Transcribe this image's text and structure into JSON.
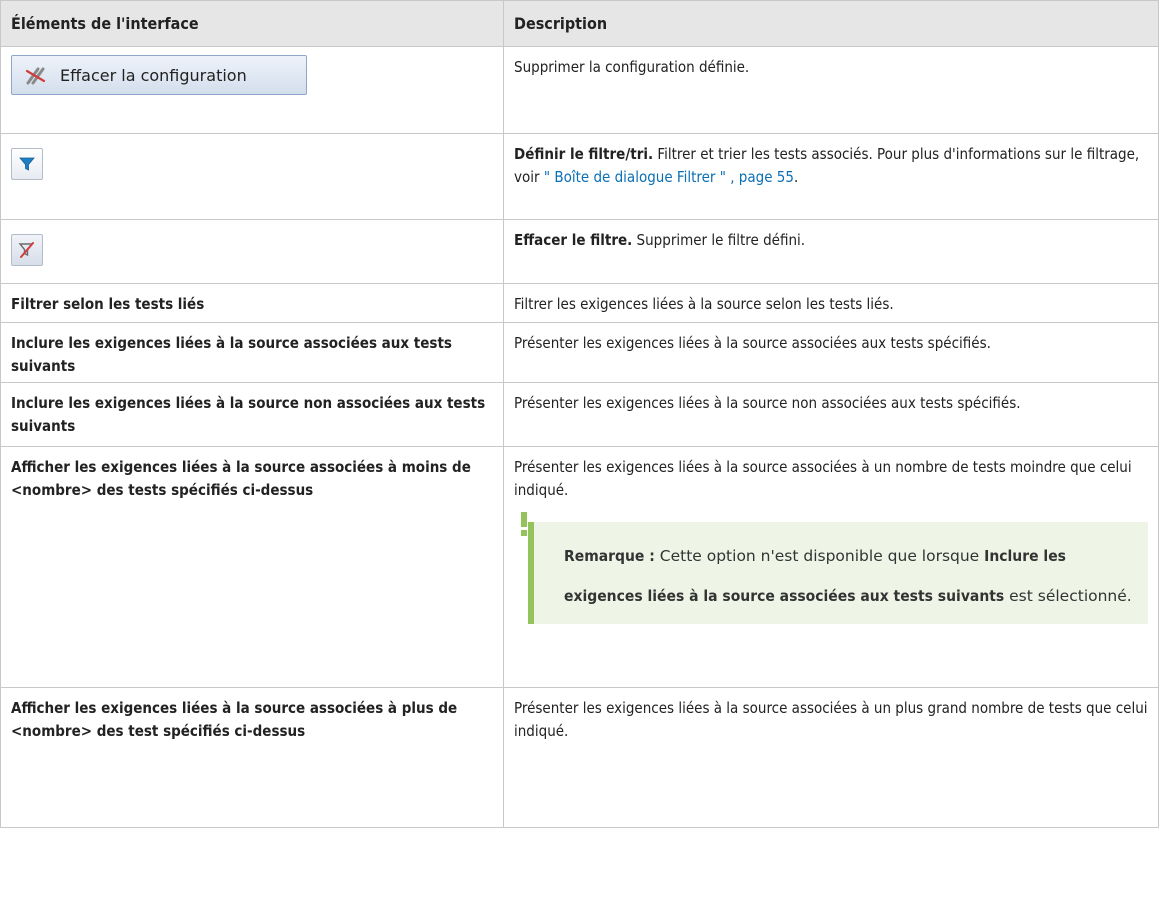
{
  "table": {
    "header": {
      "col1": "Éléments de l'interface",
      "col2": "Description"
    },
    "rows": [
      {
        "element_button_label": "Effacer la configuration",
        "description": "Supprimer la configuration définie."
      },
      {
        "element_icon": "filter-icon",
        "description_bold": "Définir le filtre/tri.",
        "description_text": " Filtrer et trier les tests associés. Pour plus d'informations sur le filtrage, voir ",
        "description_link": "\" Boîte de dialogue Filtrer \" , page 55",
        "description_end": "."
      },
      {
        "element_icon": "clear-filter-icon",
        "description_bold": "Effacer le filtre.",
        "description_text": " Supprimer le filtre défini."
      },
      {
        "element": "Filtrer selon les tests liés",
        "description": "Filtrer les exigences liées à la source selon les tests liés."
      },
      {
        "element": "Inclure les exigences liées à la source associées aux tests suivants",
        "description": "Présenter les exigences liées à la source associées aux tests spécifiés."
      },
      {
        "element": "Inclure les exigences liées à la source non associées aux tests suivants",
        "description": "Présenter les exigences liées à la source non associées aux tests spécifiés."
      },
      {
        "element": "Afficher les exigences liées à la source associées à moins de <nombre> des tests spécifiés ci-dessus",
        "description": "Présenter les exigences liées à la source associées à un nombre de tests moindre que celui indiqué.",
        "note": {
          "label": "Remarque :",
          "text1": " Cette option n'est disponible que lorsque ",
          "bold": "Inclure les exigences liées à la source associées aux tests suivants",
          "text2": " est sélectionné."
        }
      },
      {
        "element": "Afficher les exigences liées à la source associées à plus de <nombre> des test spécifiés ci-dessus",
        "description": "Présenter les exigences liées à la source associées à un plus grand nombre de tests que celui indiqué."
      }
    ]
  },
  "colors": {
    "header_bg": "#e6e6e6",
    "link": "#0a6fb5",
    "note_bg": "#eef5e6",
    "note_bar": "#93c35a",
    "filter_icon": "#1f7fc6"
  }
}
